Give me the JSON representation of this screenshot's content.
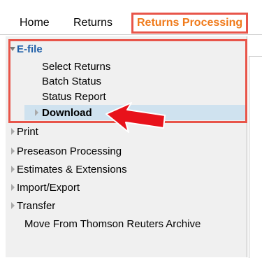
{
  "menu": {
    "items": [
      {
        "label": "Home"
      },
      {
        "label": "Returns"
      },
      {
        "label": "Returns Processing"
      }
    ]
  },
  "sidebar": {
    "efile": {
      "label": "E-file",
      "children": [
        {
          "label": "Select Returns"
        },
        {
          "label": "Batch Status"
        },
        {
          "label": "Status Report"
        },
        {
          "label": "Download"
        }
      ]
    },
    "items": [
      {
        "label": "Print"
      },
      {
        "label": "Preseason Processing"
      },
      {
        "label": "Estimates & Extensions"
      },
      {
        "label": "Import/Export"
      },
      {
        "label": "Transfer"
      },
      {
        "label": "Move From Thomson Reuters Archive"
      }
    ]
  },
  "colors": {
    "highlight_border": "#e8554a",
    "accent_text": "#f07a1a",
    "link_blue": "#1f5fa8",
    "selected_bg": "#cfe2ef",
    "arrow_red": "#e8121b"
  }
}
